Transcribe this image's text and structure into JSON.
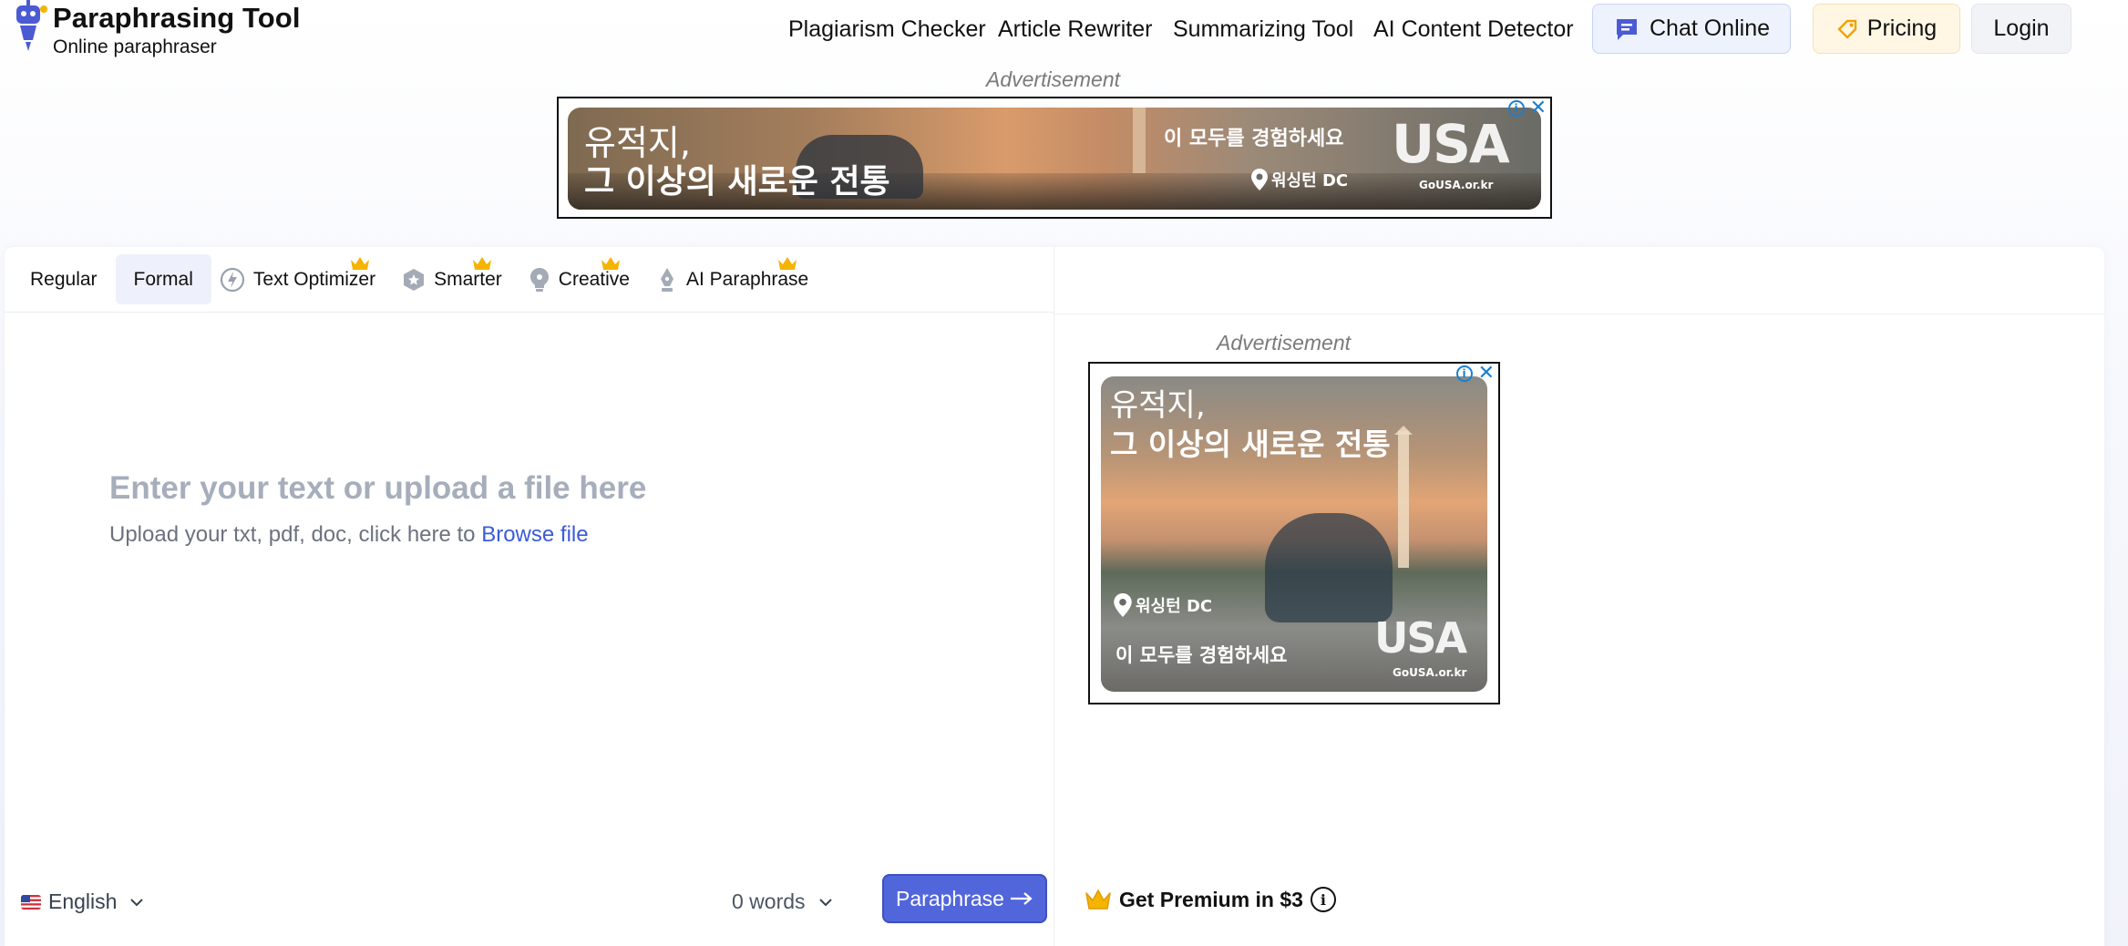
{
  "brand": {
    "title": "Paraphrasing Tool",
    "subtitle": "Online paraphraser"
  },
  "nav": {
    "links": [
      "Plagiarism Checker",
      "Article Rewriter",
      "Summarizing Tool",
      "AI Content Detector"
    ],
    "chat_label": "Chat Online",
    "pricing_label": "Pricing",
    "login_label": "Login"
  },
  "ad_top": {
    "label": "Advertisement",
    "line1": "유적지,",
    "line2": "그 이상의 새로운 전통",
    "tagline": "이 모두를 경험하세요",
    "location": "워싱턴 DC",
    "logo": "USA",
    "site": "GoUSA.or.kr"
  },
  "ad_side": {
    "label": "Advertisement",
    "line1": "유적지,",
    "line2": "그 이상의 새로운 전통",
    "location": "워싱턴 DC",
    "tagline": "이 모두를 경험하세요",
    "logo": "USA",
    "site": "GoUSA.or.kr"
  },
  "modes": [
    {
      "label": "Regular",
      "active": false,
      "premium": false,
      "icon": "none"
    },
    {
      "label": "Formal",
      "active": true,
      "premium": false,
      "icon": "none"
    },
    {
      "label": "Text Optimizer",
      "active": false,
      "premium": true,
      "icon": "lightning-icon"
    },
    {
      "label": "Smarter",
      "active": false,
      "premium": true,
      "icon": "hexagon-star-icon"
    },
    {
      "label": "Creative",
      "active": false,
      "premium": true,
      "icon": "lightbulb-icon"
    },
    {
      "label": "AI Paraphrase",
      "active": false,
      "premium": true,
      "icon": "pen-nib-icon"
    }
  ],
  "editor": {
    "placeholder": "Enter your text or upload a file here",
    "upload_hint": "Upload your txt, pdf, doc, click here to",
    "browse_link": "Browse file"
  },
  "footer": {
    "language": "English",
    "word_count": "0 words",
    "paraphrase_label": "Paraphrase",
    "premium_label": "Get Premium in $3"
  },
  "colors": {
    "accent": "#5266dc",
    "link": "#3b5bd9",
    "crown": "#f5b400",
    "chat_bg": "#eef2fd",
    "pricing_bg": "#fff7e4"
  }
}
